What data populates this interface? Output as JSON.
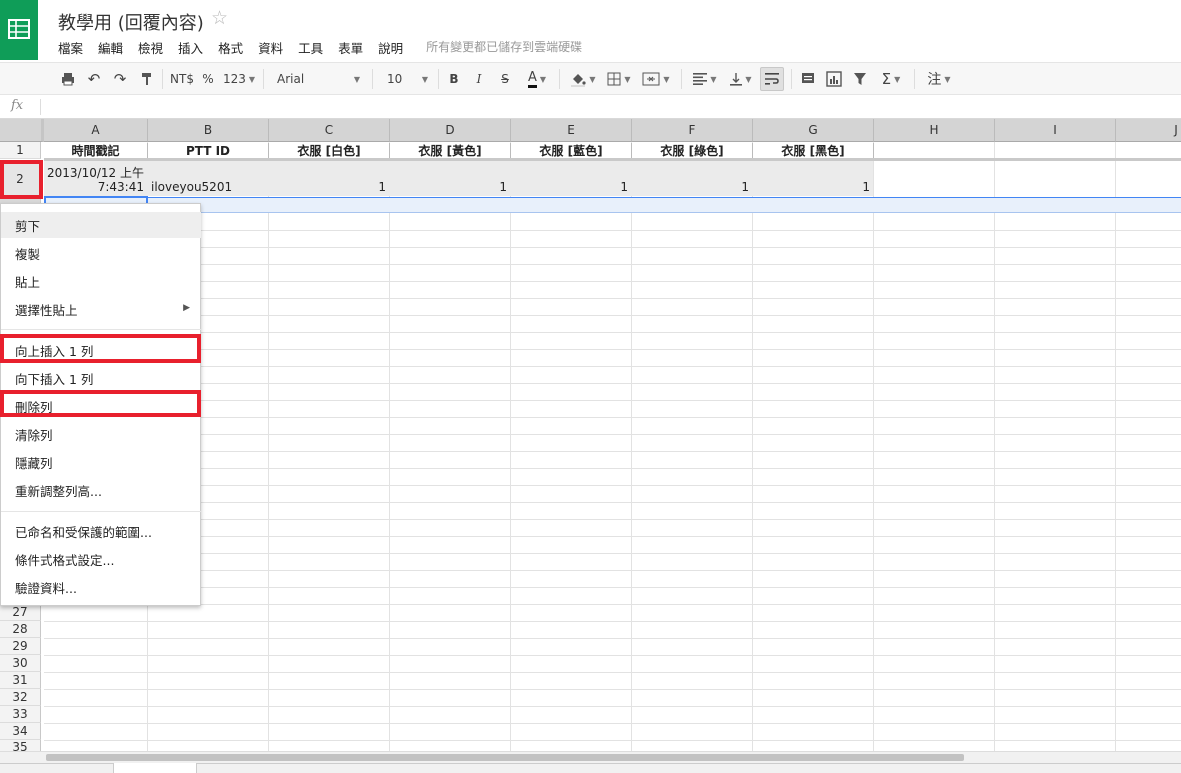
{
  "app": {
    "title": "教學用 (回覆內容)",
    "star": "☆",
    "menus": [
      "檔案",
      "編輯",
      "檢視",
      "插入",
      "格式",
      "資料",
      "工具",
      "表單",
      "說明"
    ],
    "save_status": "所有變更都已儲存到雲端硬碟"
  },
  "toolbar": {
    "currency": "NT$",
    "percent": "%",
    "more_formats": "123",
    "font": "Arial",
    "font_size": "10",
    "bold": "B",
    "italic": "I",
    "strike": "S",
    "text_color": "A",
    "sigma": "Σ",
    "comment": "注",
    "accent_green": "#0f9d58"
  },
  "formula": {
    "label": "fx",
    "value": ""
  },
  "grid": {
    "columns": [
      "A",
      "B",
      "C",
      "D",
      "E",
      "F",
      "G",
      "H",
      "I",
      "J"
    ],
    "header_row": [
      "時間戳記",
      "PTT ID",
      "衣服 [白色]",
      "衣服 [黃色]",
      "衣服 [藍色]",
      "衣服 [綠色]",
      "衣服 [黑色]"
    ],
    "data_row": {
      "timestamp_date": "2013/10/12 上午",
      "timestamp_time": "7:43:41",
      "ptt_id": "iloveyou5201",
      "values": [
        "1",
        "1",
        "1",
        "1",
        "1"
      ]
    },
    "row_numbers_top": [
      "1",
      "2"
    ],
    "row_numbers_bottom": [
      "27",
      "28",
      "29",
      "30",
      "31",
      "32",
      "33",
      "34",
      "35"
    ]
  },
  "context_menu": {
    "items": [
      {
        "label": "剪下"
      },
      {
        "label": "複製"
      },
      {
        "label": "貼上"
      },
      {
        "label": "選擇性貼上"
      },
      {
        "label": "向上插入 1 列"
      },
      {
        "label": "向下插入 1 列"
      },
      {
        "label": "刪除列"
      },
      {
        "label": "清除列"
      },
      {
        "label": "隱藏列"
      },
      {
        "label": "重新調整列高..."
      },
      {
        "label": "已命名和受保護的範圍..."
      },
      {
        "label": "條件式格式設定..."
      },
      {
        "label": "驗證資料..."
      }
    ],
    "submenu_arrow": "▶"
  },
  "colors": {
    "highlight_red": "#e8202d",
    "selection_blue": "#4285f4"
  }
}
